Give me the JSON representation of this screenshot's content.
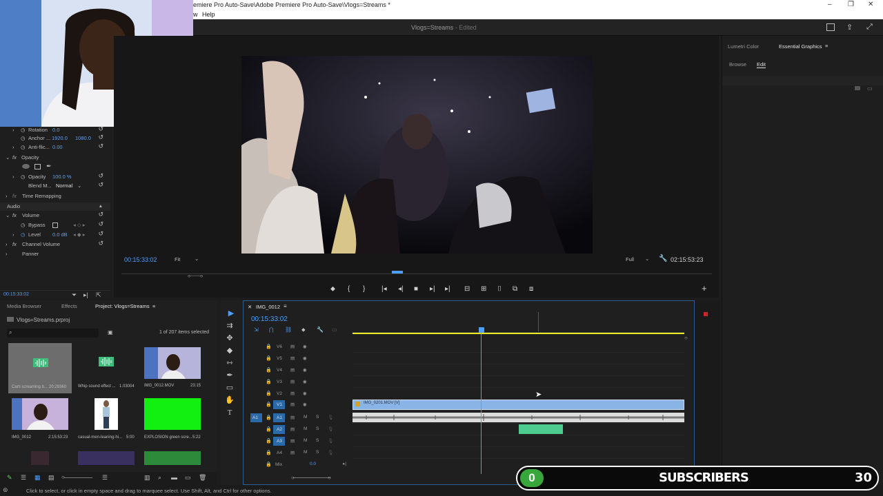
{
  "window": {
    "title": "emiere Pro Auto-Save\\Adobe Premiere Pro Auto-Save\\Vlogs=Streams *",
    "menu": [
      "w",
      "Help"
    ],
    "sequence_title": "Vlogs=Streams",
    "edited_label": "- Edited"
  },
  "effects": {
    "rotation_label": "Rotation",
    "rotation_value": "0.0",
    "anchor_label": "Anchor ...",
    "anchor_x": "1920.0",
    "anchor_y": "1080.0",
    "antiflicker_label": "Anti-flic...",
    "antiflicker_value": "0.00",
    "opacity_section": "Opacity",
    "opacity_label": "Opacity",
    "opacity_value": "100.0 %",
    "blend_label": "Blend M...",
    "blend_value": "Normal",
    "time_remap": "Time Remapping",
    "audio_header": "Audio",
    "volume": "Volume",
    "bypass": "Bypass",
    "level_label": "Level",
    "level_value": "0.0 dB",
    "channel_volume": "Channel Volume",
    "panner": "Panner",
    "timecode": "00:15:33:02"
  },
  "program": {
    "timecode": "00:15:33:02",
    "fit": "Fit",
    "quality": "Full",
    "duration": "02:15:53:23"
  },
  "right_panel": {
    "tabs": [
      "Lumetri Color",
      "Essential Graphics"
    ],
    "subtabs": [
      "Browse",
      "Edit"
    ]
  },
  "project": {
    "tabs": [
      "Media Browser",
      "Effects",
      "Project: Vlogs=Streams"
    ],
    "file": "Vlogs=Streams.prproj",
    "selection": "1 of 207 items selected",
    "items": [
      {
        "name": "Carti screaming b...",
        "dur": "20:29360"
      },
      {
        "name": "Whip sound effect ...",
        "dur": "1.03004"
      },
      {
        "name": "IMG_0012.MOV",
        "dur": "23:15"
      },
      {
        "name": "IMG_0012",
        "dur": "2:15:53:23"
      },
      {
        "name": "casual-men-leaning-hi...",
        "dur": "5:00"
      },
      {
        "name": "EXPLOSION green scre...",
        "dur": "5:22"
      }
    ]
  },
  "timeline": {
    "tab": "IMG_0012",
    "timecode": "00:15:33:02",
    "video_tracks": [
      "V6",
      "V5",
      "V4",
      "V3",
      "V2",
      "V1"
    ],
    "audio_tracks": [
      "A1",
      "A2",
      "A3",
      "A4"
    ],
    "source_track": "A1",
    "mix_label": "Mix",
    "mix_value": "0.0",
    "clip_label": "IMG_0201.MOV [V]"
  },
  "status": "Click to select, or click in empty space and drag to marquee select. Use Shift, Alt, and Ctrl for other options.",
  "overlay": {
    "count": "0",
    "label": "SUBSCRIBERS",
    "goal": "30"
  },
  "colors": {
    "accent": "#4a9fff",
    "clip_blue": "#8ab4e6",
    "audio_green": "#4ecb8e",
    "subs_green": "#37a63b"
  }
}
